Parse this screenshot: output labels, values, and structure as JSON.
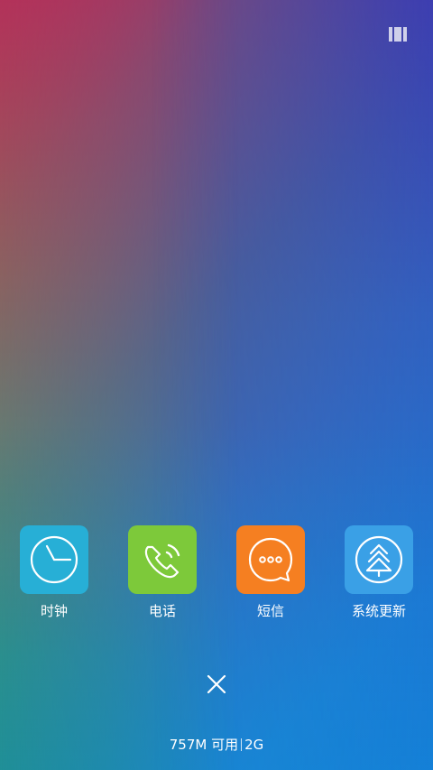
{
  "recents": {
    "apps": [
      {
        "label": "时钟",
        "color": "#27afd6",
        "icon": "clock-icon"
      },
      {
        "label": "电话",
        "color": "#7dc93a",
        "icon": "phone-icon"
      },
      {
        "label": "短信",
        "color": "#f57f21",
        "icon": "message-icon"
      },
      {
        "label": "系统更新",
        "color": "#3aa0e6",
        "icon": "system-update-icon"
      }
    ]
  },
  "footer": {
    "memory_available": "757M 可用",
    "memory_total": "2G"
  },
  "icons": {
    "top_right": "view-mode-icon",
    "close": "close-all-icon"
  }
}
